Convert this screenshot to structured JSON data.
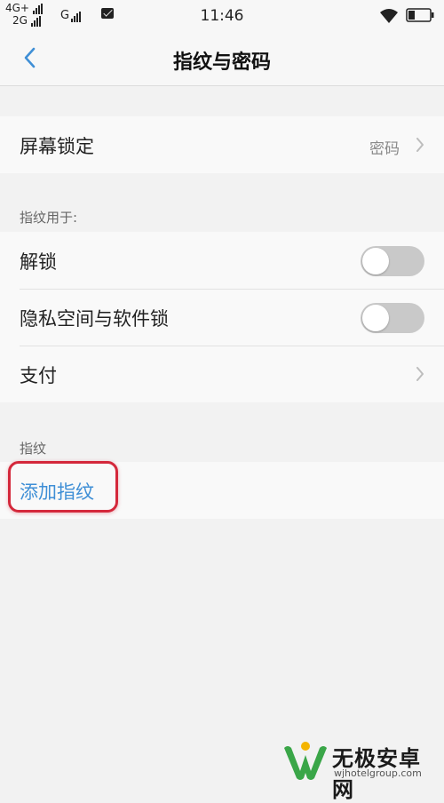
{
  "status_bar": {
    "network_top": "4G+",
    "network_bottom": "2G",
    "network_g": "G",
    "time": "11:46"
  },
  "header": {
    "title": "指纹与密码",
    "back_icon": "chevron-left-icon"
  },
  "screen_lock": {
    "label": "屏幕锁定",
    "value": "密码"
  },
  "fingerprint_use": {
    "section_label": "指纹用于:",
    "items": [
      {
        "label": "解锁",
        "control": "toggle",
        "on": false
      },
      {
        "label": "隐私空间与软件锁",
        "control": "toggle",
        "on": false
      },
      {
        "label": "支付",
        "control": "chevron"
      }
    ]
  },
  "fingerprint": {
    "section_label": "指纹",
    "add_label": "添加指纹"
  },
  "colors": {
    "accent": "#3f8fd6",
    "highlight": "#d4283b",
    "background": "#f2f2f2"
  },
  "watermark": {
    "name": "无极安卓网",
    "url": "wjhotelgroup.com"
  }
}
